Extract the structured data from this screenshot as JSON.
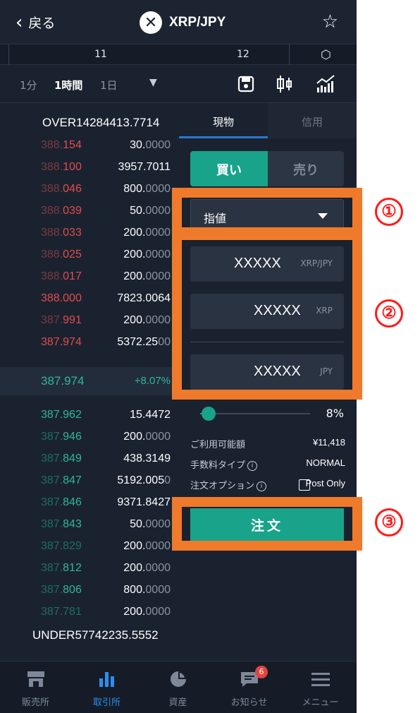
{
  "header": {
    "back_label": "戻る",
    "pair": "XRP/JPY"
  },
  "timeline": {
    "label_a": "11",
    "label_b": "12"
  },
  "intervals": [
    {
      "label": "1分"
    },
    {
      "label": "1時間"
    },
    {
      "label": "1日"
    }
  ],
  "orderbook": {
    "over": "OVER14284413.7714",
    "asks": [
      {
        "price_a": "388.",
        "price_b": "154",
        "qty_a": "30.",
        "qty_b": "0000"
      },
      {
        "price_a": "388.",
        "price_b": "100",
        "qty_a": "3957.7011",
        "qty_b": ""
      },
      {
        "price_a": "388.",
        "price_b": "046",
        "qty_a": "800.",
        "qty_b": "0000"
      },
      {
        "price_a": "388.",
        "price_b": "039",
        "qty_a": "50.",
        "qty_b": "0000"
      },
      {
        "price_a": "388.",
        "price_b": "033",
        "qty_a": "200.",
        "qty_b": "0000"
      },
      {
        "price_a": "388.",
        "price_b": "025",
        "qty_a": "200.",
        "qty_b": "0000"
      },
      {
        "price_a": "388.",
        "price_b": "017",
        "qty_a": "200.",
        "qty_b": "0000"
      },
      {
        "price_a": "388.",
        "price_b": "000",
        "qty_a": "7823.0064",
        "qty_b": ""
      },
      {
        "price_a": "387.",
        "price_b": "991",
        "qty_a": "200.",
        "qty_b": "0000"
      },
      {
        "price_a": "387.",
        "price_b": "974",
        "qty_a": "5372.25",
        "qty_b": "00"
      }
    ],
    "last_price": "387.974",
    "change": "+8.07%",
    "bids": [
      {
        "price_a": "387.",
        "price_b": "962",
        "qty_a": "15.4472",
        "qty_b": ""
      },
      {
        "price_a": "387.",
        "price_b": "946",
        "qty_a": "200.",
        "qty_b": "0000"
      },
      {
        "price_a": "387.",
        "price_b": "849",
        "qty_a": "438.3149",
        "qty_b": ""
      },
      {
        "price_a": "387.",
        "price_b": "847",
        "qty_a": "5192.005",
        "qty_b": "0"
      },
      {
        "price_a": "387.",
        "price_b": "846",
        "qty_a": "9371.8427",
        "qty_b": ""
      },
      {
        "price_a": "387.",
        "price_b": "843",
        "qty_a": "50.",
        "qty_b": "0000"
      },
      {
        "price_a": "387.",
        "price_b": "829",
        "qty_a": "200.",
        "qty_b": "0000"
      },
      {
        "price_a": "387.",
        "price_b": "812",
        "qty_a": "200.",
        "qty_b": "0000"
      },
      {
        "price_a": "387.",
        "price_b": "806",
        "qty_a": "800.",
        "qty_b": "0000"
      },
      {
        "price_a": "387.",
        "price_b": "781",
        "qty_a": "200.",
        "qty_b": "0000"
      }
    ],
    "under": "UNDER57742235.5552"
  },
  "panel": {
    "tab_spot": "現物",
    "tab_margin": "信用",
    "buy": "買い",
    "sell": "売り",
    "order_type": "指値",
    "price_value": "XXXXX",
    "price_unit": "XRP/JPY",
    "amount_value": "XXXXX",
    "amount_unit": "XRP",
    "total_value": "XXXXX",
    "total_unit": "JPY",
    "slider_percent": "8%",
    "slider_level": 0.08,
    "available_label": "ご利用可能額",
    "available_value": "¥11,418",
    "fee_label": "手数料タイプ",
    "fee_value": "NORMAL",
    "option_label": "注文オプション",
    "post_only": "Post Only",
    "order_button": "注文"
  },
  "nav": [
    {
      "label": "販売所"
    },
    {
      "label": "取引所"
    },
    {
      "label": "資産"
    },
    {
      "label": "お知らせ",
      "badge": "6"
    },
    {
      "label": "メニュー"
    }
  ],
  "annotations": {
    "m1": "①",
    "m2": "②",
    "m3": "③"
  },
  "colors": {
    "accent": "#18a38a",
    "ask": "#e24c4c",
    "bid": "#2fb79b",
    "annotation": "#ef7a2c",
    "marker": "#ff1a1a",
    "nav_active": "#2a8ff0"
  }
}
